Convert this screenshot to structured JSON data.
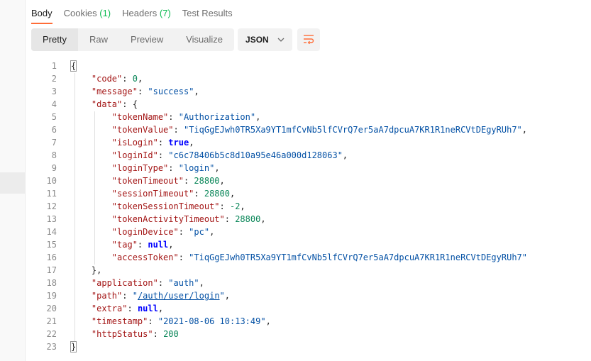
{
  "tabs": [
    {
      "label": "Body",
      "count": ""
    },
    {
      "label": "Cookies",
      "count": "(1)"
    },
    {
      "label": "Headers",
      "count": "(7)"
    },
    {
      "label": "Test Results",
      "count": ""
    }
  ],
  "view_modes": [
    "Pretty",
    "Raw",
    "Preview",
    "Visualize"
  ],
  "format": {
    "selected": "JSON"
  },
  "icons": {
    "dropdown": "chevron-down-icon",
    "wrap": "wrap-lines-icon"
  },
  "colors": {
    "accent": "#ff6c37",
    "count": "#0cbb52"
  },
  "response": {
    "lines": [
      {
        "n": "1",
        "t": [
          [
            "p",
            "{"
          ]
        ]
      },
      {
        "n": "2",
        "t": [
          [
            "p",
            "    "
          ],
          [
            "k",
            "\"code\""
          ],
          [
            "p",
            ": "
          ],
          [
            "n",
            "0"
          ],
          [
            "p",
            ","
          ]
        ]
      },
      {
        "n": "3",
        "t": [
          [
            "p",
            "    "
          ],
          [
            "k",
            "\"message\""
          ],
          [
            "p",
            ": "
          ],
          [
            "s",
            "\"success\""
          ],
          [
            "p",
            ","
          ]
        ]
      },
      {
        "n": "4",
        "t": [
          [
            "p",
            "    "
          ],
          [
            "k",
            "\"data\""
          ],
          [
            "p",
            ": {"
          ]
        ]
      },
      {
        "n": "5",
        "t": [
          [
            "p",
            "        "
          ],
          [
            "k",
            "\"tokenName\""
          ],
          [
            "p",
            ": "
          ],
          [
            "s",
            "\"Authorization\""
          ],
          [
            "p",
            ","
          ]
        ]
      },
      {
        "n": "6",
        "t": [
          [
            "p",
            "        "
          ],
          [
            "k",
            "\"tokenValue\""
          ],
          [
            "p",
            ": "
          ],
          [
            "s",
            "\"TiqGgEJwh0TR5Xa9YT1mfCvNb5lfCVrQ7er5aA7dpcuA7KR1R1neRCVtDEgyRUh7\""
          ],
          [
            "p",
            ","
          ]
        ]
      },
      {
        "n": "7",
        "t": [
          [
            "p",
            "        "
          ],
          [
            "k",
            "\"isLogin\""
          ],
          [
            "p",
            ": "
          ],
          [
            "b",
            "true"
          ],
          [
            "p",
            ","
          ]
        ]
      },
      {
        "n": "8",
        "t": [
          [
            "p",
            "        "
          ],
          [
            "k",
            "\"loginId\""
          ],
          [
            "p",
            ": "
          ],
          [
            "s",
            "\"c6c78406b5c8d10a95e46a000d128063\""
          ],
          [
            "p",
            ","
          ]
        ]
      },
      {
        "n": "9",
        "t": [
          [
            "p",
            "        "
          ],
          [
            "k",
            "\"loginType\""
          ],
          [
            "p",
            ": "
          ],
          [
            "s",
            "\"login\""
          ],
          [
            "p",
            ","
          ]
        ]
      },
      {
        "n": "10",
        "t": [
          [
            "p",
            "        "
          ],
          [
            "k",
            "\"tokenTimeout\""
          ],
          [
            "p",
            ": "
          ],
          [
            "n",
            "28800"
          ],
          [
            "p",
            ","
          ]
        ]
      },
      {
        "n": "11",
        "t": [
          [
            "p",
            "        "
          ],
          [
            "k",
            "\"sessionTimeout\""
          ],
          [
            "p",
            ": "
          ],
          [
            "n",
            "28800"
          ],
          [
            "p",
            ","
          ]
        ]
      },
      {
        "n": "12",
        "t": [
          [
            "p",
            "        "
          ],
          [
            "k",
            "\"tokenSessionTimeout\""
          ],
          [
            "p",
            ": "
          ],
          [
            "n",
            "-2"
          ],
          [
            "p",
            ","
          ]
        ]
      },
      {
        "n": "13",
        "t": [
          [
            "p",
            "        "
          ],
          [
            "k",
            "\"tokenActivityTimeout\""
          ],
          [
            "p",
            ": "
          ],
          [
            "n",
            "28800"
          ],
          [
            "p",
            ","
          ]
        ]
      },
      {
        "n": "14",
        "t": [
          [
            "p",
            "        "
          ],
          [
            "k",
            "\"loginDevice\""
          ],
          [
            "p",
            ": "
          ],
          [
            "s",
            "\"pc\""
          ],
          [
            "p",
            ","
          ]
        ]
      },
      {
        "n": "15",
        "t": [
          [
            "p",
            "        "
          ],
          [
            "k",
            "\"tag\""
          ],
          [
            "p",
            ": "
          ],
          [
            "b",
            "null"
          ],
          [
            "p",
            ","
          ]
        ]
      },
      {
        "n": "16",
        "t": [
          [
            "p",
            "        "
          ],
          [
            "k",
            "\"accessToken\""
          ],
          [
            "p",
            ": "
          ],
          [
            "s",
            "\"TiqGgEJwh0TR5Xa9YT1mfCvNb5lfCVrQ7er5aA7dpcuA7KR1R1neRCVtDEgyRUh7\""
          ]
        ]
      },
      {
        "n": "17",
        "t": [
          [
            "p",
            "    },"
          ]
        ]
      },
      {
        "n": "18",
        "t": [
          [
            "p",
            "    "
          ],
          [
            "k",
            "\"application\""
          ],
          [
            "p",
            ": "
          ],
          [
            "s",
            "\"auth\""
          ],
          [
            "p",
            ","
          ]
        ]
      },
      {
        "n": "19",
        "t": [
          [
            "p",
            "    "
          ],
          [
            "k",
            "\"path\""
          ],
          [
            "p",
            ": "
          ],
          [
            "s",
            "\""
          ],
          [
            "u",
            "/auth/user/login"
          ],
          [
            "s",
            "\""
          ],
          [
            "p",
            ","
          ]
        ]
      },
      {
        "n": "20",
        "t": [
          [
            "p",
            "    "
          ],
          [
            "k",
            "\"extra\""
          ],
          [
            "p",
            ": "
          ],
          [
            "b",
            "null"
          ],
          [
            "p",
            ","
          ]
        ]
      },
      {
        "n": "21",
        "t": [
          [
            "p",
            "    "
          ],
          [
            "k",
            "\"timestamp\""
          ],
          [
            "p",
            ": "
          ],
          [
            "s",
            "\"2021-08-06 10:13:49\""
          ],
          [
            "p",
            ","
          ]
        ]
      },
      {
        "n": "22",
        "t": [
          [
            "p",
            "    "
          ],
          [
            "k",
            "\"httpStatus\""
          ],
          [
            "p",
            ": "
          ],
          [
            "n",
            "200"
          ]
        ]
      },
      {
        "n": "23",
        "t": [
          [
            "p",
            "}"
          ]
        ]
      }
    ]
  }
}
